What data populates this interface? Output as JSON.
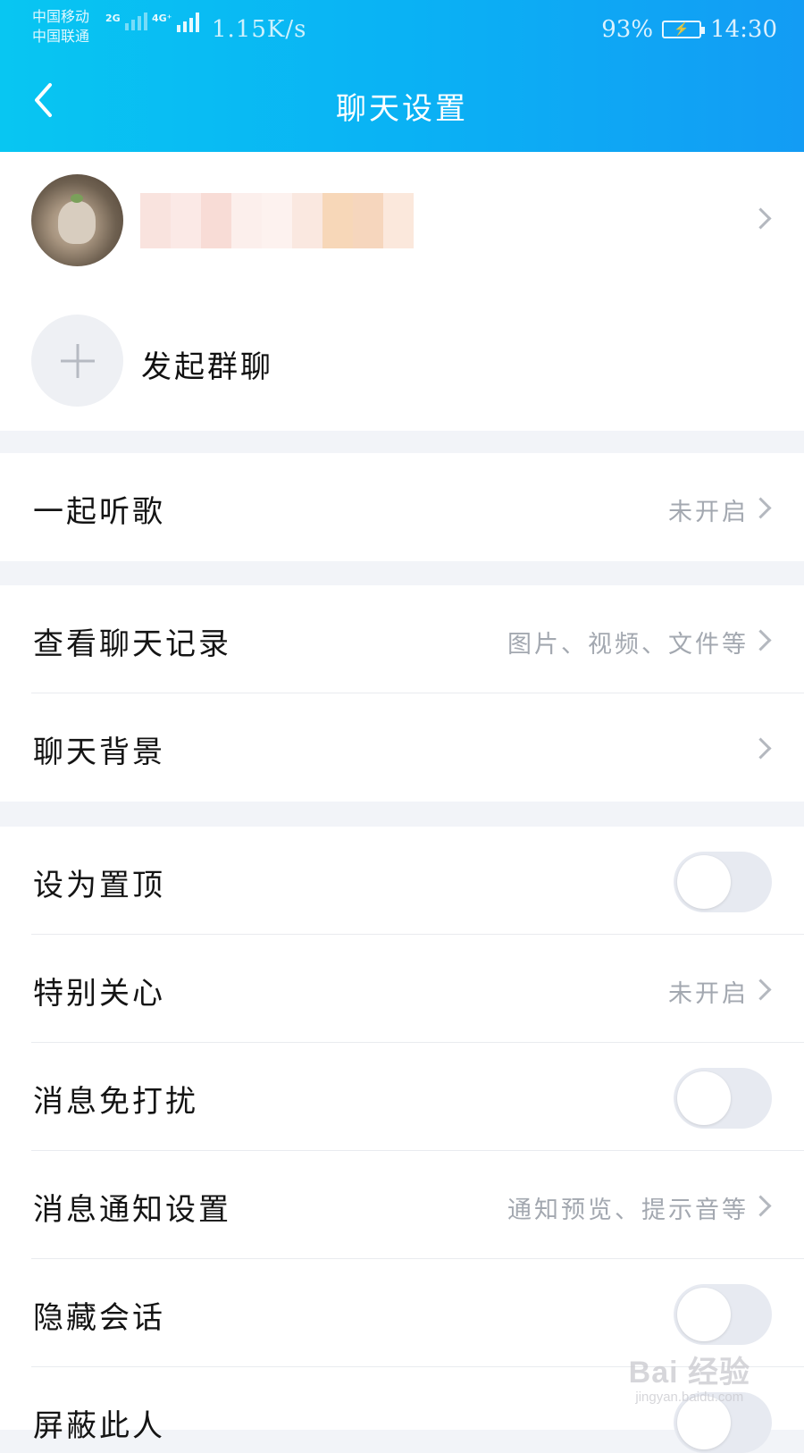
{
  "status_bar": {
    "carrier1": "中国移动",
    "carrier2": "中国联通",
    "net1": "2G",
    "net2": "4G⁺",
    "speed": "1.15K/s",
    "battery_percent": "93%",
    "time": "14:30"
  },
  "header": {
    "title": "聊天设置",
    "back_icon": "chevron-left-icon"
  },
  "profile": {
    "group_chat_label": "发起群聊"
  },
  "rows": {
    "listen_together": {
      "label": "一起听歌",
      "value": "未开启"
    },
    "chat_history": {
      "label": "查看聊天记录",
      "value": "图片、视频、文件等"
    },
    "chat_background": {
      "label": "聊天背景"
    },
    "pin_top": {
      "label": "设为置顶",
      "on": false
    },
    "special_care": {
      "label": "特别关心",
      "value": "未开启"
    },
    "do_not_disturb": {
      "label": "消息免打扰",
      "on": false
    },
    "notification_settings": {
      "label": "消息通知设置",
      "value": "通知预览、提示音等"
    },
    "hide_conversation": {
      "label": "隐藏会话",
      "on": false
    },
    "block_user": {
      "label": "屏蔽此人"
    }
  },
  "watermark": {
    "main": "Bai 经验",
    "sub": "jingyan.baidu.com"
  },
  "colors": {
    "header_gradient_start": "#08c6f2",
    "header_gradient_end": "#139cf4",
    "background": "#f2f4f8",
    "secondary_text": "#a3a8b0",
    "toggle_off": "#e7eaf1"
  }
}
